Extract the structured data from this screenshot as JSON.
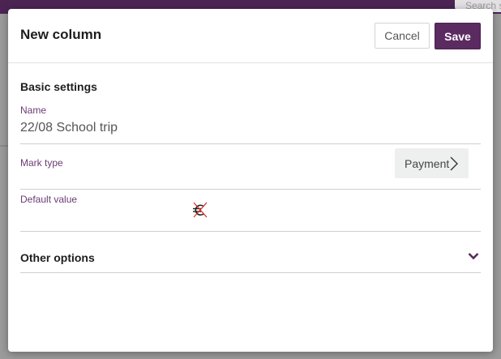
{
  "background": {
    "search_placeholder": "Search s"
  },
  "modal": {
    "title": "New column",
    "cancel_label": "Cancel",
    "save_label": "Save"
  },
  "basic_settings": {
    "heading": "Basic settings",
    "name_label": "Name",
    "name_value": "22/08 School trip",
    "mark_type_label": "Mark type",
    "mark_type_value": "Payment",
    "default_value_label": "Default value",
    "default_value_icon": "no-currency-icon"
  },
  "other_options": {
    "label": "Other options",
    "expanded": false
  },
  "colors": {
    "brand": "#5b2a61",
    "topbar": "#4b2454",
    "label": "#6b3b73",
    "icon_strike": "#d9342b"
  }
}
